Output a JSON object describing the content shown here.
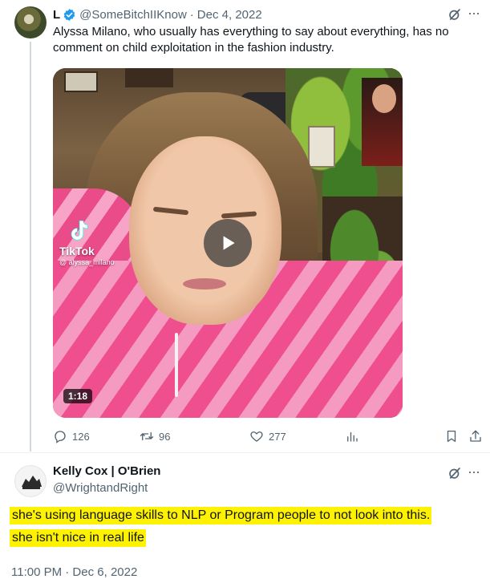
{
  "tweet1": {
    "author_name": "L",
    "handle": "@SomeBitchIIKnow",
    "separator": "·",
    "date": "Dec 4, 2022",
    "text": "Alyssa Milano, who usually has everything to say about everything, has no comment on child exploitation in the fashion industry.",
    "media": {
      "watermark_brand": "TikTok",
      "watermark_handle": "@ alyssa_milano",
      "duration": "1:18"
    },
    "actions": {
      "replies": "126",
      "retweets": "96",
      "likes": "277"
    },
    "icons": [
      "grok-icon",
      "more-icon",
      "verified-badge-icon",
      "reply-icon",
      "retweet-icon",
      "like-icon",
      "views-icon",
      "bookmark-icon",
      "share-icon",
      "play-icon",
      "tiktok-logo-icon"
    ]
  },
  "tweet2": {
    "author_name": "Kelly Cox | O'Brien",
    "handle": "@WrightandRight",
    "text_line1": "she's using language skills to NLP or Program people to not look into this.",
    "text_line2": "she  isn't nice in real life",
    "timestamp": "11:00 PM · Dec 6, 2022",
    "highlight_color": "#fff200"
  },
  "colors": {
    "verified_blue": "#1d9bf0",
    "secondary_text": "#536471",
    "primary_text": "#0f1419"
  }
}
